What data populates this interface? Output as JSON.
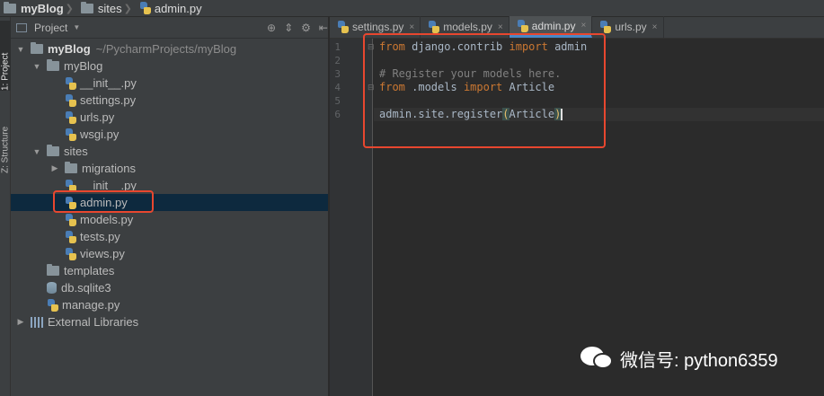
{
  "breadcrumb": [
    "myBlog",
    "sites",
    "admin.py"
  ],
  "side_tabs": {
    "project": "1: Project",
    "structure": "Z: Structure"
  },
  "panel": {
    "title": "Project"
  },
  "tree": [
    {
      "label": "myBlog",
      "path": "~/PycharmProjects/myBlog",
      "depth": 0,
      "arrow": "down",
      "icon": "folder",
      "bold": true
    },
    {
      "label": "myBlog",
      "depth": 1,
      "arrow": "down",
      "icon": "folder"
    },
    {
      "label": "__init__.py",
      "depth": 2,
      "icon": "py"
    },
    {
      "label": "settings.py",
      "depth": 2,
      "icon": "py"
    },
    {
      "label": "urls.py",
      "depth": 2,
      "icon": "py"
    },
    {
      "label": "wsgi.py",
      "depth": 2,
      "icon": "py"
    },
    {
      "label": "sites",
      "depth": 1,
      "arrow": "down",
      "icon": "folder"
    },
    {
      "label": "migrations",
      "depth": 2,
      "arrow": "right",
      "icon": "folder"
    },
    {
      "label": "__init__.py",
      "depth": 2,
      "icon": "py"
    },
    {
      "label": "admin.py",
      "depth": 2,
      "icon": "py",
      "selected": true
    },
    {
      "label": "models.py",
      "depth": 2,
      "icon": "py"
    },
    {
      "label": "tests.py",
      "depth": 2,
      "icon": "py"
    },
    {
      "label": "views.py",
      "depth": 2,
      "icon": "py"
    },
    {
      "label": "templates",
      "depth": 1,
      "icon": "folder"
    },
    {
      "label": "db.sqlite3",
      "depth": 1,
      "icon": "db"
    },
    {
      "label": "manage.py",
      "depth": 1,
      "icon": "py"
    },
    {
      "label": "External Libraries",
      "depth": 0,
      "arrow": "right",
      "icon": "lib"
    }
  ],
  "tabs": [
    {
      "label": "settings.py",
      "close": "×"
    },
    {
      "label": "models.py",
      "close": "×"
    },
    {
      "label": "admin.py",
      "close": "×",
      "active": true
    },
    {
      "label": "urls.py",
      "close": "×"
    }
  ],
  "code": {
    "line_numbers": [
      "1",
      "2",
      "3",
      "4",
      "5",
      "6"
    ],
    "line1": {
      "kw1": "from",
      "mid": " django.contrib ",
      "kw2": "import",
      "end": " admin"
    },
    "line3": "# Register your models here.",
    "line4": {
      "kw1": "from",
      "mid": " .models ",
      "kw2": "import",
      "end": " Article"
    },
    "line6": {
      "pre": "admin.site.register",
      "open": "(",
      "arg": "Article",
      "close": ")"
    }
  },
  "watermark": {
    "text": "微信号: python6359"
  },
  "colors": {
    "highlight": "#e8472f",
    "selection": "#0d293e",
    "keyword": "#cc7832",
    "comment": "#808080"
  }
}
